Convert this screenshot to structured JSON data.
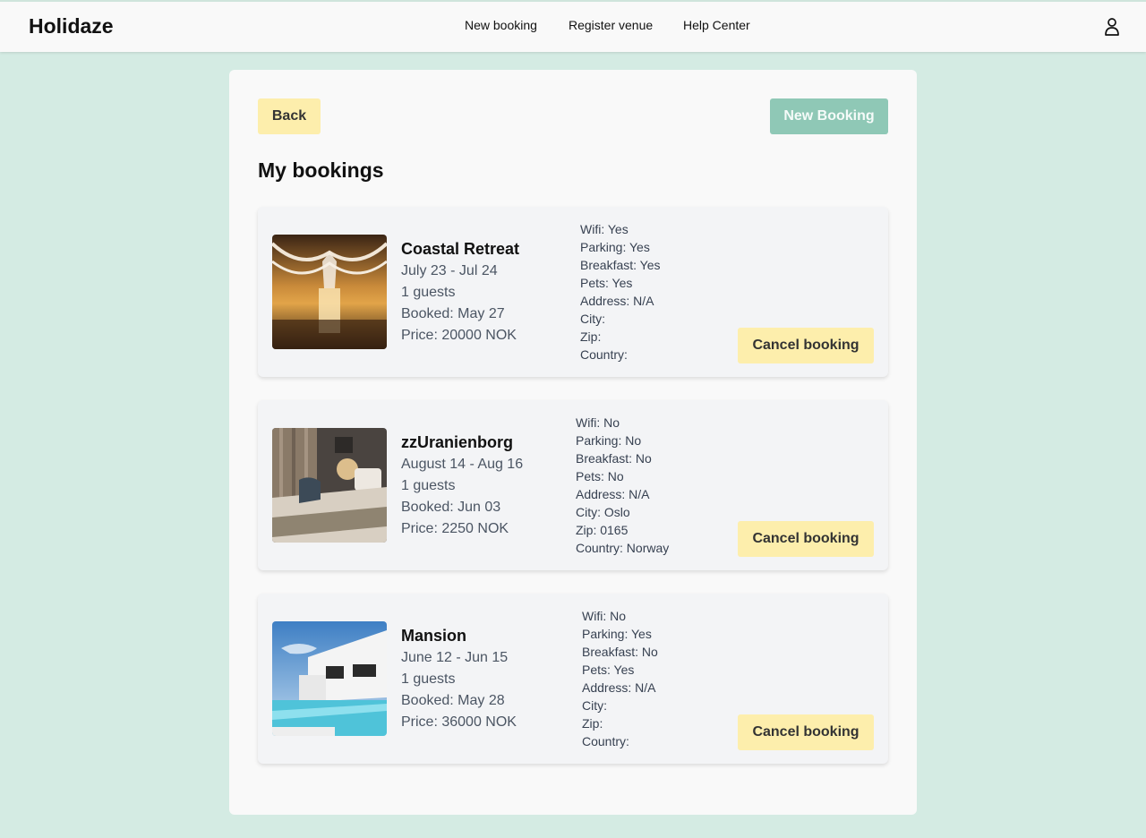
{
  "app": {
    "logo": "Holidaze",
    "nav": [
      "New booking",
      "Register venue",
      "Help Center"
    ],
    "user_icon": "user-icon"
  },
  "page": {
    "back_label": "Back",
    "new_booking_label": "New Booking",
    "title": "My bookings",
    "cancel_label": "Cancel booking"
  },
  "bookings": [
    {
      "name": "Coastal Retreat",
      "dates": "July 23 - Jul 24",
      "guests": "1 guests",
      "booked": "Booked: May 27",
      "price": "Price: 20000 NOK",
      "wifi": "Wifi: Yes",
      "parking": "Parking: Yes",
      "breakfast": "Breakfast: Yes",
      "pets": "Pets: Yes",
      "address": "Address: N/A",
      "city": "City:",
      "zip": "Zip:",
      "country": "Country:"
    },
    {
      "name": "zzUranienborg",
      "dates": "August 14 - Aug 16",
      "guests": "1 guests",
      "booked": "Booked: Jun 03",
      "price": "Price: 2250 NOK",
      "wifi": "Wifi: No",
      "parking": "Parking: No",
      "breakfast": "Breakfast: No",
      "pets": "Pets: No",
      "address": "Address: N/A",
      "city": "City: Oslo",
      "zip": "Zip: 0165",
      "country": "Country: Norway"
    },
    {
      "name": "Mansion",
      "dates": "June 12 - Jun 15",
      "guests": "1 guests",
      "booked": "Booked: May 28",
      "price": "Price: 36000 NOK",
      "wifi": "Wifi: No",
      "parking": "Parking: Yes",
      "breakfast": "Breakfast: No",
      "pets": "Pets: Yes",
      "address": "Address: N/A",
      "city": "City:",
      "zip": "Zip:",
      "country": "Country:"
    }
  ],
  "colors": {
    "background": "#d4ebe3",
    "panel": "#f9f9f9",
    "card": "#f3f4f6",
    "accent_yellow": "#fdeeac",
    "accent_green": "#8fc8b6"
  }
}
